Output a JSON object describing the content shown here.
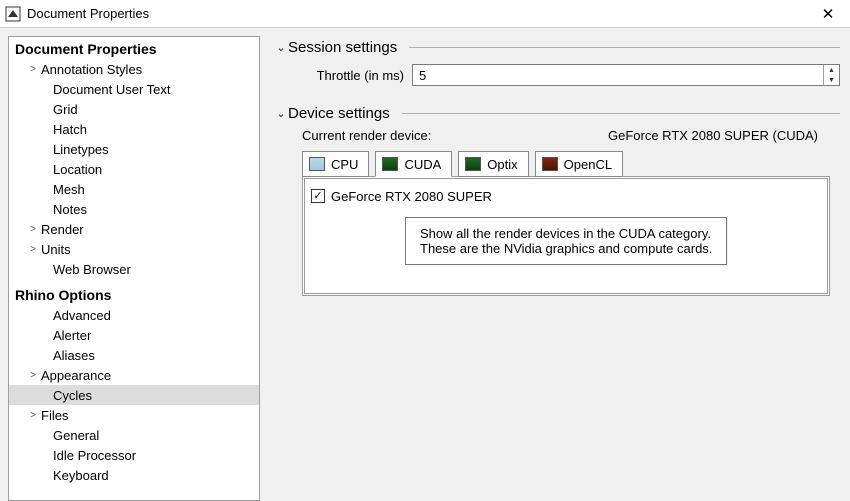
{
  "titlebar": {
    "title": "Document Properties",
    "close": "✕"
  },
  "sidebar": {
    "section1": "Document Properties",
    "section2": "Rhino Options",
    "items1": [
      {
        "label": "Annotation Styles",
        "expand": true,
        "depth": 1
      },
      {
        "label": "Document User Text",
        "expand": false,
        "depth": 2
      },
      {
        "label": "Grid",
        "expand": false,
        "depth": 2
      },
      {
        "label": "Hatch",
        "expand": false,
        "depth": 2
      },
      {
        "label": "Linetypes",
        "expand": false,
        "depth": 2
      },
      {
        "label": "Location",
        "expand": false,
        "depth": 2
      },
      {
        "label": "Mesh",
        "expand": false,
        "depth": 2
      },
      {
        "label": "Notes",
        "expand": false,
        "depth": 2
      },
      {
        "label": "Render",
        "expand": true,
        "depth": 1
      },
      {
        "label": "Units",
        "expand": true,
        "depth": 1
      },
      {
        "label": "Web Browser",
        "expand": false,
        "depth": 2
      }
    ],
    "items2": [
      {
        "label": "Advanced",
        "expand": false,
        "depth": 2
      },
      {
        "label": "Alerter",
        "expand": false,
        "depth": 2
      },
      {
        "label": "Aliases",
        "expand": false,
        "depth": 2
      },
      {
        "label": "Appearance",
        "expand": true,
        "depth": 1
      },
      {
        "label": "Cycles",
        "expand": false,
        "depth": 2,
        "selected": true
      },
      {
        "label": "Files",
        "expand": true,
        "depth": 1
      },
      {
        "label": "General",
        "expand": false,
        "depth": 2
      },
      {
        "label": "Idle Processor",
        "expand": false,
        "depth": 2
      },
      {
        "label": "Keyboard",
        "expand": false,
        "depth": 2
      }
    ]
  },
  "session": {
    "title": "Session settings",
    "throttle_label": "Throttle (in ms)",
    "throttle_value": "5"
  },
  "device": {
    "title": "Device settings",
    "current_label": "Current render device:",
    "current_value": "GeForce RTX 2080 SUPER (CUDA)",
    "tabs": [
      {
        "label": "CPU",
        "chip": "cpu"
      },
      {
        "label": "CUDA",
        "chip": "cuda",
        "active": true
      },
      {
        "label": "Optix",
        "chip": "optix"
      },
      {
        "label": "OpenCL",
        "chip": "opencl"
      }
    ],
    "list": [
      {
        "label": "GeForce RTX 2080 SUPER",
        "checked": true
      }
    ],
    "tooltip_line1": "Show all the render devices in the CUDA category.",
    "tooltip_line2": "These are the NVidia graphics and compute cards."
  }
}
